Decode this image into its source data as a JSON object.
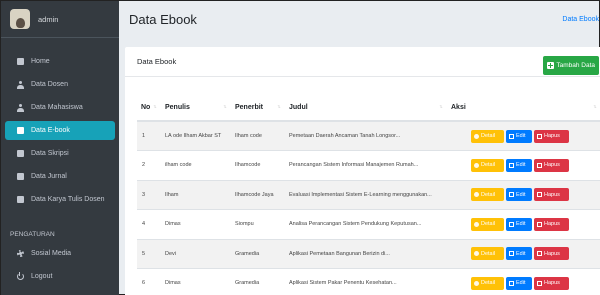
{
  "sidebar": {
    "user": "admin",
    "items": [
      {
        "label": "Home",
        "icon": "home-icon"
      },
      {
        "label": "Data Dosen",
        "icon": "user-icon"
      },
      {
        "label": "Data Mahasiswa",
        "icon": "users-icon"
      },
      {
        "label": "Data E-book",
        "icon": "book-icon",
        "active": true
      },
      {
        "label": "Data Skripsi",
        "icon": "book-icon"
      },
      {
        "label": "Data Jurnal",
        "icon": "book-icon"
      },
      {
        "label": "Data Karya Tulis Dosen",
        "icon": "book-icon"
      }
    ],
    "section_header": "PENGATURAN",
    "settings": [
      {
        "label": "Sosial Media",
        "icon": "gear-icon"
      },
      {
        "label": "Logout",
        "icon": "power-icon"
      }
    ]
  },
  "header": {
    "title": "Data Ebook",
    "breadcrumb": "Data Ebook"
  },
  "card": {
    "title": "Data Ebook",
    "add_button": "Tambah Data"
  },
  "table": {
    "columns": [
      "No",
      "Penulis",
      "Penerbit",
      "Judul",
      "Aksi"
    ],
    "rows": [
      {
        "no": "1",
        "penulis": "LA ode Ilham Akbar ST",
        "penerbit": "Ilham code",
        "judul": "Pemetaan Daerah Ancaman Tanah Longsor..."
      },
      {
        "no": "2",
        "penulis": "ilham code",
        "penerbit": "Ilhamcode",
        "judul": "Perancangan Sistem Informasi Manajemen Rumah..."
      },
      {
        "no": "3",
        "penulis": "Ilham",
        "penerbit": "Ilhamcode Jaya",
        "judul": "Evaluasi Implementasi Sistem E-Learning menggunakan..."
      },
      {
        "no": "4",
        "penulis": "Dimas",
        "penerbit": "Siompu",
        "judul": "Analisa Perancangan Sistem Pendukung Keputusan..."
      },
      {
        "no": "5",
        "penulis": "Devi",
        "penerbit": "Gramedia",
        "judul": "Aplikasi Pemetaan Bangunan Berizin di..."
      },
      {
        "no": "6",
        "penulis": "Dimas",
        "penerbit": "Gramedia",
        "judul": "Aplikasi Sistem Pakar Penentu Kesehatan..."
      }
    ],
    "actions": {
      "detail": "Detail",
      "edit": "Edit",
      "hapus": "Hapus"
    }
  },
  "colors": {
    "sidebar": "#343a40",
    "active": "#17a2b8",
    "add": "#28a745",
    "detail": "#ffc107",
    "edit": "#007bff",
    "hapus": "#dc3545"
  }
}
